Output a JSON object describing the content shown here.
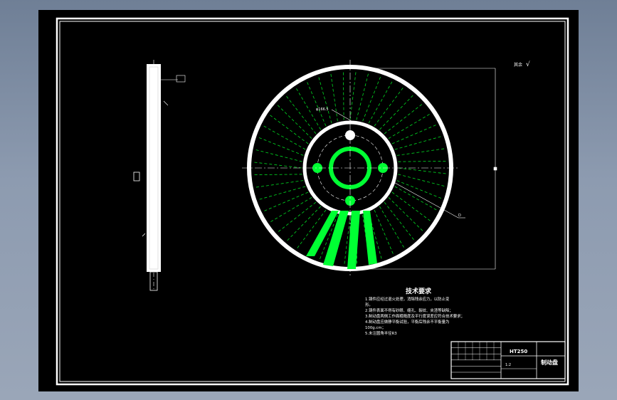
{
  "drawing": {
    "background": "#000000",
    "line_color": "#ffffff",
    "accent_color": "#00ff33",
    "dash_color": "#00dd22"
  },
  "annotations": {
    "roughness_note": "其余",
    "roughness_symbol": "√",
    "tolerance_box": "▲",
    "radius_note": "φ166.5",
    "diameter_note": "D"
  },
  "tech_req": {
    "title": "技术要求",
    "lines": [
      "1.铸件应经过退火处理，消除残余应力，以防止变",
      "形。",
      "2.铸件表面不得有砂眼、缩孔、裂纹、夹渣等缺陷；",
      "3.制动盘两侧工作面粗糙度及平行度误差应符合技术要求；",
      "4.制动盘应做静平衡试验，平衡后残余不平衡量为",
      "100g.cm；",
      "5.未注圆角半径R3"
    ]
  },
  "title_block": {
    "material": "HT250",
    "name": "制动盘",
    "scale_note": "1:2"
  }
}
